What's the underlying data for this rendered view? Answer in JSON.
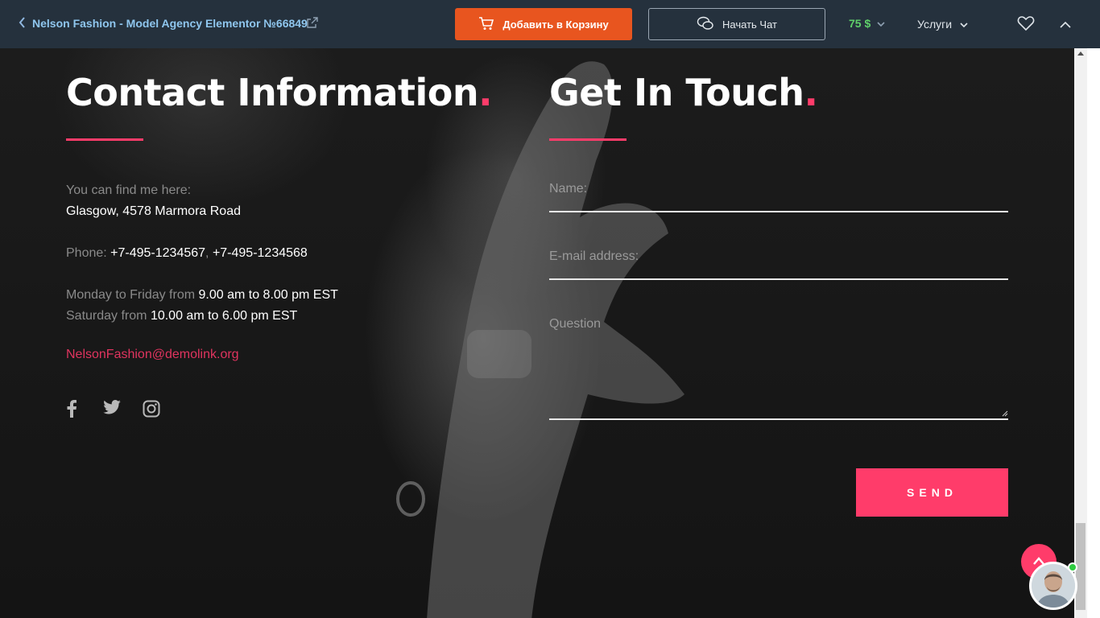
{
  "topbar": {
    "back_icon": "chevron-left-icon",
    "title": "Nelson Fashion - Model Agency Elementor №66849",
    "external_icon": "external-link-icon",
    "cart_button": "Добавить в Корзину",
    "chat_button": "Начать Чат",
    "price": "75 $",
    "services": "Услуги",
    "colors": {
      "bar": "#25313d",
      "cart": "#e8551f",
      "price": "#5fd06a",
      "title": "#8fc6ee"
    }
  },
  "contact": {
    "title": "Contact Information",
    "title_dot": ".",
    "find_label": "You can find me here:",
    "address": "Glasgow, 4578 Marmora Road",
    "phone_label": "Phone: ",
    "phone1": "+7-495-1234567",
    "phone_sep": ", ",
    "phone2": "+7-495-1234568",
    "weekday_label": "Monday to Friday from ",
    "weekday_hours": "9.00 am to 8.00 pm EST",
    "saturday_label": "Saturday from ",
    "saturday_hours": "10.00 am to 6.00 pm EST",
    "email": "NelsonFashion@demolink.org",
    "social": [
      "facebook-icon",
      "twitter-icon",
      "instagram-icon"
    ]
  },
  "form": {
    "title": "Get In Touch",
    "title_dot": ".",
    "name_placeholder": "Name:",
    "email_placeholder": "E-mail address:",
    "question_placeholder": "Question",
    "send_label": "SEND",
    "accent": "#ff3c6a"
  }
}
